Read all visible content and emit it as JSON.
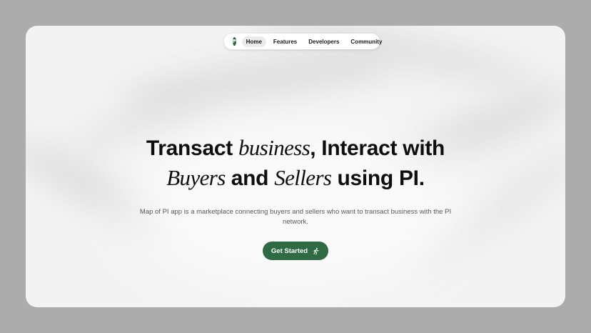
{
  "nav": {
    "logo_glyph": "₱",
    "items": [
      {
        "label": "Home",
        "active": true
      },
      {
        "label": "Features",
        "active": false
      },
      {
        "label": "Developers",
        "active": false
      },
      {
        "label": "Community",
        "active": false
      }
    ]
  },
  "hero": {
    "line1_a": "Transact ",
    "line1_em": "business",
    "line1_b": ", Interact with",
    "line2_em1": "Buyers",
    "line2_a": " and ",
    "line2_em2": "Sellers",
    "line2_b": " using PI.",
    "subtitle": "Map of PI app is a marketplace connecting buyers and sellers who want to transact business with the PI network.",
    "cta_label": "Get Started",
    "cta_icon": "running-person-icon"
  },
  "colors": {
    "brand": "#2f6a43",
    "background": "#f3f3f3",
    "outer": "#acacac"
  }
}
